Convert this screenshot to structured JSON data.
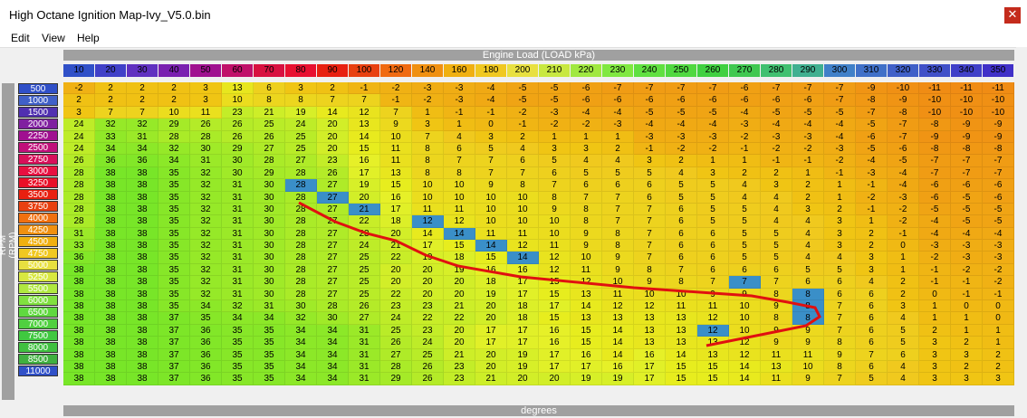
{
  "window": {
    "title": "High Octane Ignition Map-Ivy_V5.0.bin",
    "close_glyph": "✕"
  },
  "menu": [
    "Edit",
    "View",
    "Help"
  ],
  "header_top": "Engine Load (LOAD kPa)",
  "header_bottom": "degrees",
  "side_label": "RPM (RPM)",
  "load_axis": [
    "10",
    "20",
    "30",
    "40",
    "50",
    "60",
    "70",
    "80",
    "90",
    "100",
    "120",
    "140",
    "160",
    "180",
    "200",
    "210",
    "220",
    "230",
    "240",
    "250",
    "260",
    "270",
    "280",
    "290",
    "300",
    "310",
    "320",
    "330",
    "340",
    "350"
  ],
  "rpm_axis": [
    "500",
    "1000",
    "1500",
    "2000",
    "2250",
    "2500",
    "2750",
    "3000",
    "3250",
    "3500",
    "3750",
    "4000",
    "4250",
    "4500",
    "4750",
    "5000",
    "5250",
    "5500",
    "6000",
    "6500",
    "7000",
    "7500",
    "8000",
    "8500",
    "11000"
  ],
  "rows": [
    [
      "-2",
      "2",
      "2",
      "2",
      "3",
      "13",
      "6",
      "3",
      "2",
      "-1",
      "-2",
      "-3",
      "-3",
      "-4",
      "-5",
      "-5",
      "-6",
      "-7",
      "-7",
      "-7",
      "-7",
      "-6",
      "-7",
      "-7",
      "-7",
      "-9",
      "-10",
      "-11",
      "-11",
      "-11"
    ],
    [
      "2",
      "2",
      "2",
      "2",
      "3",
      "10",
      "8",
      "8",
      "7",
      "7",
      "-1",
      "-2",
      "-3",
      "-4",
      "-5",
      "-5",
      "-6",
      "-6",
      "-6",
      "-6",
      "-6",
      "-6",
      "-6",
      "-6",
      "-7",
      "-8",
      "-9",
      "-10",
      "-10",
      "-10"
    ],
    [
      "3",
      "7",
      "7",
      "10",
      "11",
      "23",
      "21",
      "19",
      "14",
      "12",
      "7",
      "1",
      "-1",
      "-1",
      "-2",
      "-3",
      "-4",
      "-4",
      "-5",
      "-5",
      "-5",
      "-4",
      "-5",
      "-5",
      "-5",
      "-7",
      "-8",
      "-10",
      "-10",
      "-10"
    ],
    [
      "24",
      "32",
      "32",
      "29",
      "26",
      "26",
      "25",
      "24",
      "20",
      "13",
      "9",
      "3",
      "1",
      "0",
      "-1",
      "-2",
      "-2",
      "-3",
      "-4",
      "-4",
      "-4",
      "-3",
      "-4",
      "-4",
      "-4",
      "-5",
      "-7",
      "-8",
      "-9",
      "-9"
    ],
    [
      "24",
      "33",
      "31",
      "28",
      "28",
      "26",
      "26",
      "25",
      "20",
      "14",
      "10",
      "7",
      "4",
      "3",
      "2",
      "1",
      "1",
      "1",
      "-3",
      "-3",
      "-3",
      "-2",
      "-3",
      "-3",
      "-4",
      "-6",
      "-7",
      "-9",
      "-9",
      "-9"
    ],
    [
      "24",
      "34",
      "34",
      "32",
      "30",
      "29",
      "27",
      "25",
      "20",
      "15",
      "11",
      "8",
      "6",
      "5",
      "4",
      "3",
      "3",
      "2",
      "-1",
      "-2",
      "-2",
      "-1",
      "-2",
      "-2",
      "-3",
      "-5",
      "-6",
      "-8",
      "-8",
      "-8"
    ],
    [
      "26",
      "36",
      "36",
      "34",
      "31",
      "30",
      "28",
      "27",
      "23",
      "16",
      "11",
      "8",
      "7",
      "7",
      "6",
      "5",
      "4",
      "4",
      "3",
      "2",
      "1",
      "1",
      "-1",
      "-1",
      "-2",
      "-4",
      "-5",
      "-7",
      "-7",
      "-7"
    ],
    [
      "28",
      "38",
      "38",
      "35",
      "32",
      "30",
      "29",
      "28",
      "26",
      "17",
      "13",
      "8",
      "8",
      "7",
      "7",
      "6",
      "5",
      "5",
      "5",
      "4",
      "3",
      "2",
      "2",
      "1",
      "-1",
      "-3",
      "-4",
      "-7",
      "-7",
      "-7"
    ],
    [
      "28",
      "38",
      "38",
      "35",
      "32",
      "31",
      "30",
      "28",
      "27",
      "19",
      "15",
      "10",
      "10",
      "9",
      "8",
      "7",
      "6",
      "6",
      "6",
      "5",
      "5",
      "4",
      "3",
      "2",
      "1",
      "-1",
      "-4",
      "-6",
      "-6",
      "-6"
    ],
    [
      "28",
      "38",
      "38",
      "35",
      "32",
      "31",
      "30",
      "28",
      "27",
      "20",
      "16",
      "10",
      "10",
      "10",
      "10",
      "8",
      "7",
      "7",
      "6",
      "5",
      "5",
      "4",
      "4",
      "2",
      "1",
      "-2",
      "-3",
      "-6",
      "-5",
      "-6"
    ],
    [
      "28",
      "38",
      "38",
      "35",
      "32",
      "31",
      "30",
      "28",
      "27",
      "21",
      "17",
      "11",
      "11",
      "10",
      "10",
      "9",
      "8",
      "7",
      "7",
      "6",
      "5",
      "5",
      "4",
      "3",
      "2",
      "-1",
      "-2",
      "-5",
      "-5",
      "-5"
    ],
    [
      "28",
      "38",
      "38",
      "35",
      "32",
      "31",
      "30",
      "28",
      "27",
      "22",
      "18",
      "12",
      "12",
      "10",
      "10",
      "10",
      "8",
      "7",
      "7",
      "6",
      "5",
      "5",
      "4",
      "4",
      "3",
      "1",
      "-2",
      "-4",
      "-5",
      "-5"
    ],
    [
      "31",
      "38",
      "38",
      "35",
      "32",
      "31",
      "30",
      "28",
      "27",
      "23",
      "20",
      "14",
      "14",
      "11",
      "11",
      "10",
      "9",
      "8",
      "7",
      "6",
      "6",
      "5",
      "5",
      "4",
      "3",
      "2",
      "-1",
      "-4",
      "-4",
      "-4"
    ],
    [
      "33",
      "38",
      "38",
      "35",
      "32",
      "31",
      "30",
      "28",
      "27",
      "24",
      "21",
      "17",
      "15",
      "14",
      "12",
      "11",
      "9",
      "8",
      "7",
      "6",
      "6",
      "5",
      "5",
      "4",
      "3",
      "2",
      "0",
      "-3",
      "-3",
      "-3"
    ],
    [
      "36",
      "38",
      "38",
      "35",
      "32",
      "31",
      "30",
      "28",
      "27",
      "25",
      "22",
      "19",
      "18",
      "15",
      "14",
      "12",
      "10",
      "9",
      "7",
      "6",
      "6",
      "5",
      "5",
      "4",
      "4",
      "3",
      "1",
      "-2",
      "-3",
      "-3"
    ],
    [
      "38",
      "38",
      "38",
      "35",
      "32",
      "31",
      "30",
      "28",
      "27",
      "25",
      "20",
      "20",
      "19",
      "16",
      "16",
      "12",
      "11",
      "9",
      "8",
      "7",
      "6",
      "6",
      "6",
      "5",
      "5",
      "3",
      "1",
      "-1",
      "-2",
      "-2"
    ],
    [
      "38",
      "38",
      "38",
      "35",
      "32",
      "31",
      "30",
      "28",
      "27",
      "25",
      "20",
      "20",
      "20",
      "18",
      "17",
      "15",
      "12",
      "10",
      "9",
      "8",
      "7",
      "7",
      "7",
      "6",
      "6",
      "4",
      "2",
      "-1",
      "-1",
      "-2"
    ],
    [
      "38",
      "38",
      "38",
      "35",
      "32",
      "31",
      "30",
      "28",
      "27",
      "25",
      "22",
      "20",
      "20",
      "19",
      "17",
      "15",
      "13",
      "11",
      "10",
      "10",
      "9",
      "9",
      "8",
      "8",
      "6",
      "6",
      "2",
      "0",
      "-1",
      "-1"
    ],
    [
      "38",
      "38",
      "38",
      "35",
      "34",
      "32",
      "31",
      "30",
      "28",
      "26",
      "23",
      "23",
      "21",
      "20",
      "18",
      "17",
      "14",
      "12",
      "12",
      "11",
      "11",
      "10",
      "9",
      "8",
      "7",
      "6",
      "3",
      "1",
      "0",
      "0"
    ],
    [
      "38",
      "38",
      "38",
      "37",
      "35",
      "34",
      "34",
      "32",
      "30",
      "27",
      "24",
      "22",
      "22",
      "20",
      "18",
      "15",
      "13",
      "13",
      "13",
      "13",
      "12",
      "10",
      "8",
      "8",
      "7",
      "6",
      "4",
      "1",
      "1",
      "0"
    ],
    [
      "38",
      "38",
      "38",
      "37",
      "36",
      "35",
      "35",
      "34",
      "34",
      "31",
      "25",
      "23",
      "20",
      "17",
      "17",
      "16",
      "15",
      "14",
      "13",
      "13",
      "12",
      "10",
      "9",
      "9",
      "7",
      "6",
      "5",
      "2",
      "1",
      "1"
    ],
    [
      "38",
      "38",
      "38",
      "37",
      "36",
      "35",
      "35",
      "34",
      "34",
      "31",
      "26",
      "24",
      "20",
      "17",
      "17",
      "16",
      "15",
      "14",
      "13",
      "13",
      "13",
      "12",
      "9",
      "9",
      "8",
      "6",
      "5",
      "3",
      "2",
      "1"
    ],
    [
      "38",
      "38",
      "38",
      "37",
      "36",
      "35",
      "35",
      "34",
      "34",
      "31",
      "27",
      "25",
      "21",
      "20",
      "19",
      "17",
      "16",
      "14",
      "16",
      "14",
      "13",
      "12",
      "11",
      "11",
      "9",
      "7",
      "6",
      "3",
      "3",
      "2"
    ],
    [
      "38",
      "38",
      "38",
      "37",
      "36",
      "35",
      "35",
      "34",
      "34",
      "31",
      "28",
      "26",
      "23",
      "20",
      "19",
      "17",
      "17",
      "16",
      "17",
      "15",
      "15",
      "14",
      "13",
      "10",
      "8",
      "6",
      "4",
      "3",
      "2",
      "2"
    ],
    [
      "38",
      "38",
      "38",
      "37",
      "36",
      "35",
      "35",
      "34",
      "34",
      "31",
      "29",
      "26",
      "23",
      "21",
      "20",
      "20",
      "19",
      "19",
      "17",
      "15",
      "15",
      "14",
      "11",
      "9",
      "7",
      "5",
      "4",
      "3",
      "3",
      "3"
    ]
  ],
  "selected_cells": [
    [
      8,
      7
    ],
    [
      9,
      8
    ],
    [
      10,
      9
    ],
    [
      11,
      11
    ],
    [
      12,
      12
    ],
    [
      13,
      13
    ],
    [
      14,
      14
    ],
    [
      16,
      21
    ],
    [
      17,
      23
    ],
    [
      18,
      23
    ],
    [
      19,
      23
    ],
    [
      20,
      20
    ]
  ],
  "colors": {
    "load_scale": [
      "#3050c8",
      "#4040c8",
      "#6030c0",
      "#7a20b0",
      "#a01090",
      "#c0106a",
      "#d81040",
      "#e81030",
      "#e82010",
      "#e84010",
      "#f06a10",
      "#f09010",
      "#f0b010",
      "#f0c820",
      "#e8e040",
      "#c8e840",
      "#a0e840",
      "#80e840",
      "#60e040",
      "#50d840",
      "#40d040",
      "#40c850",
      "#40c070",
      "#40b090",
      "#4080c8",
      "#4070c8",
      "#4060c8",
      "#4050c8",
      "#4040c8",
      "#4030c8"
    ],
    "rpm_scale": [
      "#3050c8",
      "#4060c8",
      "#5030b0",
      "#8020a0",
      "#a01090",
      "#c0107a",
      "#d8105a",
      "#e81040",
      "#e81028",
      "#e82010",
      "#e84010",
      "#f07010",
      "#f09010",
      "#f0b010",
      "#f0c820",
      "#e8e040",
      "#d8e840",
      "#b0e840",
      "#80e040",
      "#60d840",
      "#50d040",
      "#40c840",
      "#40c040",
      "#40b040",
      "#3050c8"
    ],
    "annotation_line": "#e01010"
  }
}
